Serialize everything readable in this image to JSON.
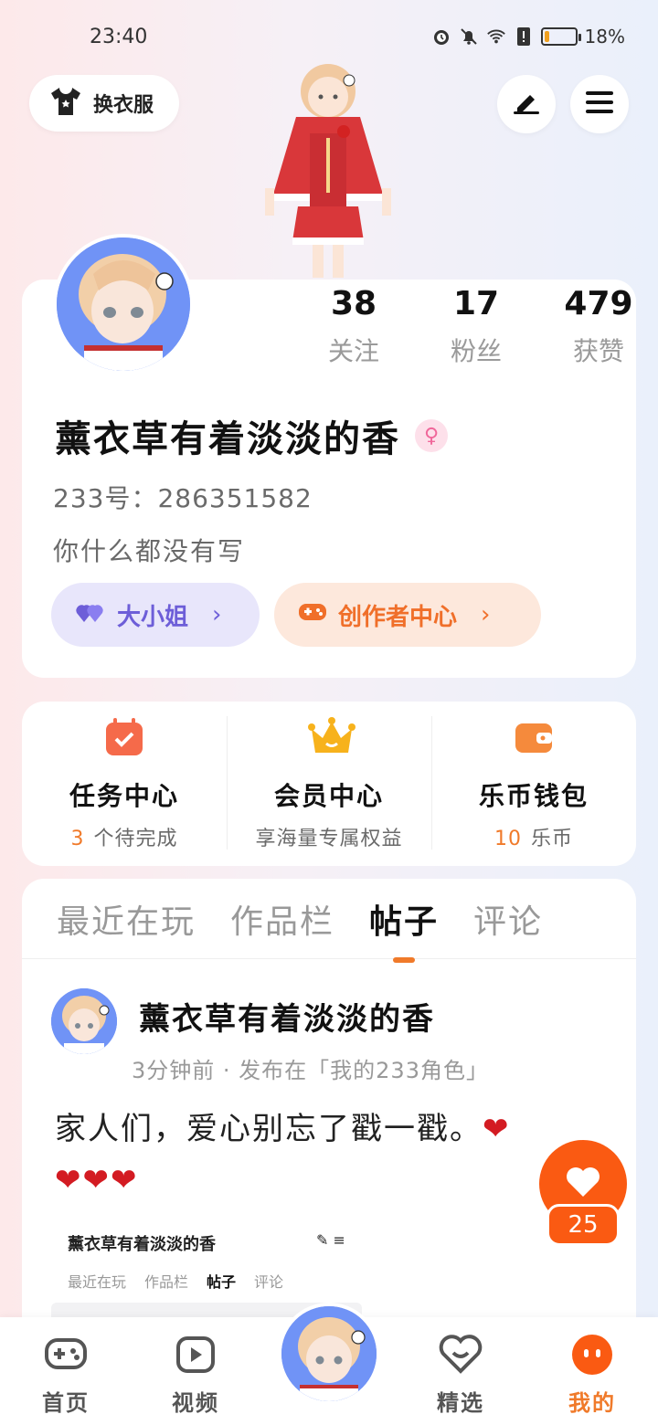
{
  "status_bar": {
    "time": "23:40",
    "battery_text": "18%",
    "battery_level": 0.18
  },
  "header": {
    "dress_label": "换衣服",
    "edit_icon": "pen-icon",
    "menu_icon": "hamburger-icon"
  },
  "profile": {
    "stats": [
      {
        "value": "38",
        "label": "关注"
      },
      {
        "value": "17",
        "label": "粉丝"
      },
      {
        "value": "479",
        "label": "获赞"
      }
    ],
    "username": "薰衣草有着淡淡的香",
    "gender_symbol": "♀",
    "id_line": "233号：286351582",
    "bio": "你什么都没有写",
    "lady_label": "大小姐",
    "creator_label": "创作者中心",
    "chevron": "›"
  },
  "services": [
    {
      "title": "任务中心",
      "num": "3",
      "sub": "个待完成",
      "icon": "calendar-check-icon",
      "color": "#f56a4a"
    },
    {
      "title": "会员中心",
      "num": "",
      "sub": "享海量专属权益",
      "icon": "crown-icon",
      "color": "#f7b21c"
    },
    {
      "title": "乐币钱包",
      "num": "10",
      "sub": "乐币",
      "icon": "wallet-icon",
      "color": "#f58a3c"
    }
  ],
  "content": {
    "tabs": [
      "最近在玩",
      "作品栏",
      "帖子",
      "评论"
    ],
    "active_tab": 2,
    "post": {
      "author": "薰衣草有着淡淡的香",
      "meta": "3分钟前 · 发布在「我的233角色」",
      "text": "家人们，爱心别忘了戳一戳。",
      "hearts_line1": "❤",
      "hearts_line2": "❤❤❤"
    },
    "preview": {
      "title": "薰衣草有着淡淡的香",
      "icons": "✎  ≡",
      "tabs": [
        "最近在玩",
        "作品栏",
        "帖子",
        "评论"
      ]
    }
  },
  "like": {
    "count": "25"
  },
  "bottom_nav": {
    "items": [
      {
        "label": "首页",
        "icon": "gamepad-icon"
      },
      {
        "label": "视频",
        "icon": "play-icon"
      },
      {
        "label": "精选",
        "icon": "heart-badge-icon"
      },
      {
        "label": "我的",
        "icon": "smiley-icon"
      }
    ],
    "active": 3
  },
  "colors": {
    "accent": "#f07a2a",
    "like_bg": "#fa5a12",
    "lady_text": "#6d5ed8",
    "avatar_bg": "#6e8ef5"
  }
}
